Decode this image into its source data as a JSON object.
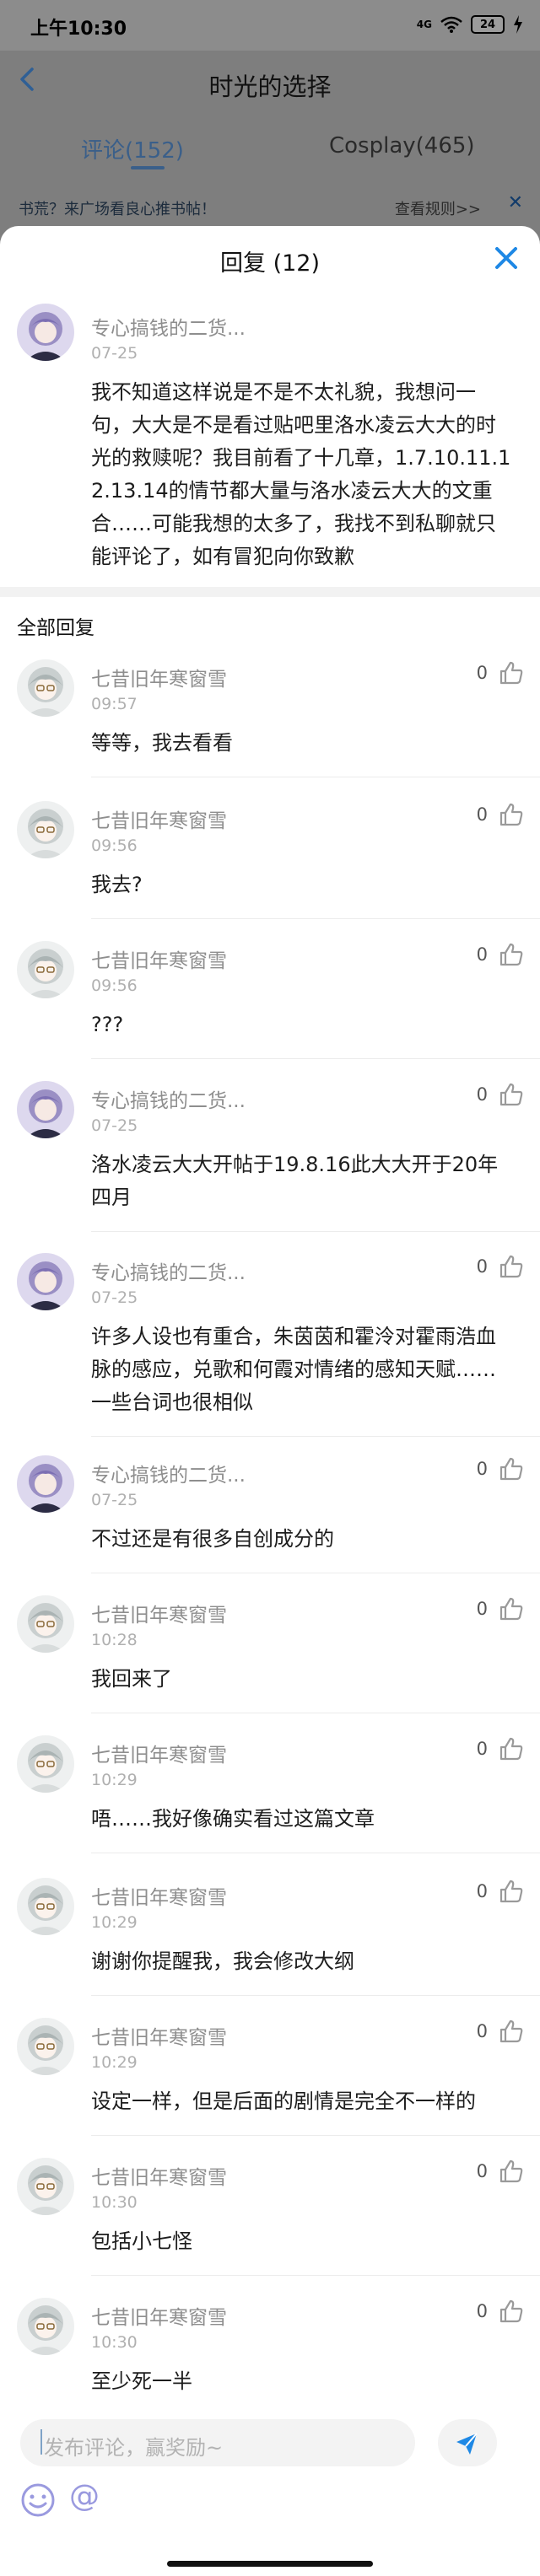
{
  "status_bar": {
    "time": "上午10:30",
    "signal_label": "4G",
    "battery": "24"
  },
  "page": {
    "title": "时光的选择",
    "tabs": [
      {
        "label": "评论(152)",
        "active": true
      },
      {
        "label": "Cosplay(465)",
        "active": false
      }
    ],
    "notice": "书荒？来广场看良心推书帖！",
    "rules_link": "查看规则>>",
    "notice_close": "✕"
  },
  "sheet": {
    "title": "回复 (12)",
    "main_comment": {
      "user": "专心搞钱的二货...",
      "date": "07-25",
      "text": "我不知道这样说是不是不太礼貌，我想问一句，大大是不是看过贴吧里洛水凌云大大的时光的救赎呢？我目前看了十几章，1.7.10.11.12.13.14的情节都大量与洛水凌云大大的文重合……可能我想的太多了，我找不到私聊就只能评论了，如有冒犯向你致歉"
    },
    "all_replies_label": "全部回复",
    "replies": [
      {
        "user": "七昔旧年寒窗雪",
        "time": "09:57",
        "text": "等等，我去看看",
        "likes": "0",
        "avatar": "b"
      },
      {
        "user": "七昔旧年寒窗雪",
        "time": "09:56",
        "text": "我去?",
        "likes": "0",
        "avatar": "b"
      },
      {
        "user": "七昔旧年寒窗雪",
        "time": "09:56",
        "text": "???",
        "likes": "0",
        "avatar": "b"
      },
      {
        "user": "专心搞钱的二货...",
        "time": "07-25",
        "text": "洛水凌云大大开帖于19.8.16此大大开于20年四月",
        "likes": "0",
        "avatar": "a"
      },
      {
        "user": "专心搞钱的二货...",
        "time": "07-25",
        "text": "许多人设也有重合，朱茵茵和霍泠对霍雨浩血脉的感应，兑歌和何霞对情绪的感知天赋……一些台词也很相似",
        "likes": "0",
        "avatar": "a"
      },
      {
        "user": "专心搞钱的二货...",
        "time": "07-25",
        "text": "不过还是有很多自创成分的",
        "likes": "0",
        "avatar": "a"
      },
      {
        "user": "七昔旧年寒窗雪",
        "time": "10:28",
        "text": "我回来了",
        "likes": "0",
        "avatar": "b"
      },
      {
        "user": "七昔旧年寒窗雪",
        "time": "10:29",
        "text": "唔……我好像确实看过这篇文章",
        "likes": "0",
        "avatar": "b"
      },
      {
        "user": "七昔旧年寒窗雪",
        "time": "10:29",
        "text": "谢谢你提醒我，我会修改大纲",
        "likes": "0",
        "avatar": "b"
      },
      {
        "user": "七昔旧年寒窗雪",
        "time": "10:29",
        "text": "设定一样，但是后面的剧情是完全不一样的",
        "likes": "0",
        "avatar": "b"
      },
      {
        "user": "七昔旧年寒窗雪",
        "time": "10:30",
        "text": "包括小七怪",
        "likes": "0",
        "avatar": "b"
      },
      {
        "user": "七昔旧年寒窗雪",
        "time": "10:30",
        "text": "至少死一半",
        "likes": "0",
        "avatar": "b"
      }
    ]
  },
  "composer": {
    "placeholder": "发布评论，赢奖励~",
    "at_symbol": "@"
  },
  "colors": {
    "accent": "#1e88e5",
    "bg_dim": "#7e7e7e",
    "muted_text": "#8e8e8e"
  },
  "icons": [
    "back-arrow-icon",
    "close-icon",
    "thumbs-up-icon",
    "send-icon",
    "emoji-icon",
    "at-icon",
    "wifi-icon",
    "signal-icon",
    "battery-icon"
  ]
}
